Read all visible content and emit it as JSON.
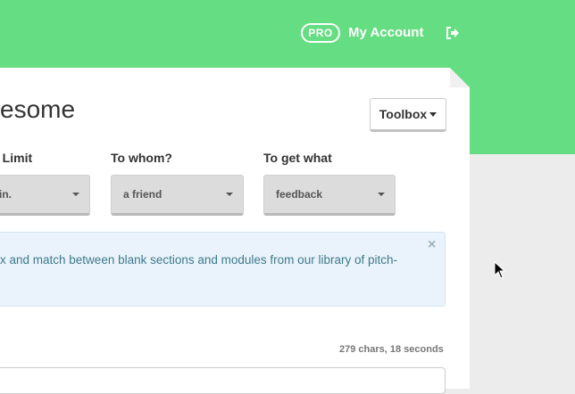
{
  "header": {
    "pro_badge": "PRO",
    "account_label": "My Account",
    "logout_icon": "sign-out-icon",
    "color": "#65dd82"
  },
  "page": {
    "title_partial": "esome"
  },
  "toolbox": {
    "label": "Toolbox"
  },
  "form": {
    "fields": [
      {
        "label": "e Limit",
        "value": "in."
      },
      {
        "label": "To whom?",
        "value": "a friend"
      },
      {
        "label": "To get what",
        "value": "feedback"
      }
    ]
  },
  "info": {
    "text": "x and match between blank sections and modules from our library of pitch-",
    "close": "×"
  },
  "stats": {
    "char_count": "279 chars, 18 seconds"
  }
}
